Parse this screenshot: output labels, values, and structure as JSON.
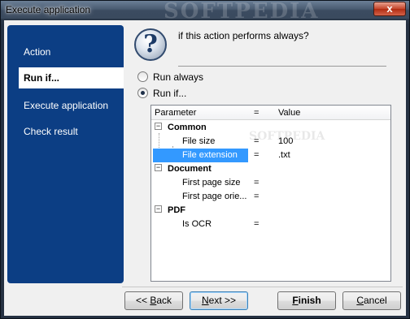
{
  "window": {
    "title": "Execute application",
    "watermark": "SOFTPEDIA",
    "close_glyph": "x"
  },
  "sidebar": {
    "items": [
      {
        "label": "Action",
        "active": false
      },
      {
        "label": "Run if...",
        "active": true
      },
      {
        "label": "Execute application",
        "active": false
      },
      {
        "label": "Check result",
        "active": false
      }
    ]
  },
  "content": {
    "question": "if this action performs always?",
    "help_icon": "question-icon",
    "radio_always": "Run always",
    "radio_if": "Run if...",
    "selected_radio": "Run if..."
  },
  "tree": {
    "headers": {
      "parameter": "Parameter",
      "eq": "=",
      "value": "Value"
    },
    "watermark": "SOFTPEDIA",
    "groups": [
      {
        "name": "Common",
        "expander": "−",
        "rows": [
          {
            "param": "File size",
            "eq": "=",
            "value": "100"
          },
          {
            "param": "File extension",
            "eq": "=",
            "value": ".txt",
            "selected": true
          }
        ]
      },
      {
        "name": "Document",
        "expander": "−",
        "rows": [
          {
            "param": "First page size",
            "eq": "=",
            "value": ""
          },
          {
            "param": "First page orie...",
            "eq": "=",
            "value": ""
          }
        ]
      },
      {
        "name": "PDF",
        "expander": "−",
        "rows": [
          {
            "param": "Is OCR",
            "eq": "=",
            "value": ""
          }
        ]
      }
    ]
  },
  "buttons": {
    "back_prefix": "<< ",
    "back_accel": "B",
    "back_rest": "ack",
    "next_accel": "N",
    "next_rest": "ext >>",
    "finish_accel": "F",
    "finish_rest": "inish",
    "cancel_accel": "C",
    "cancel_rest": "ancel"
  },
  "colors": {
    "sidebar": "#0c3e84",
    "selection": "#3399ff"
  }
}
